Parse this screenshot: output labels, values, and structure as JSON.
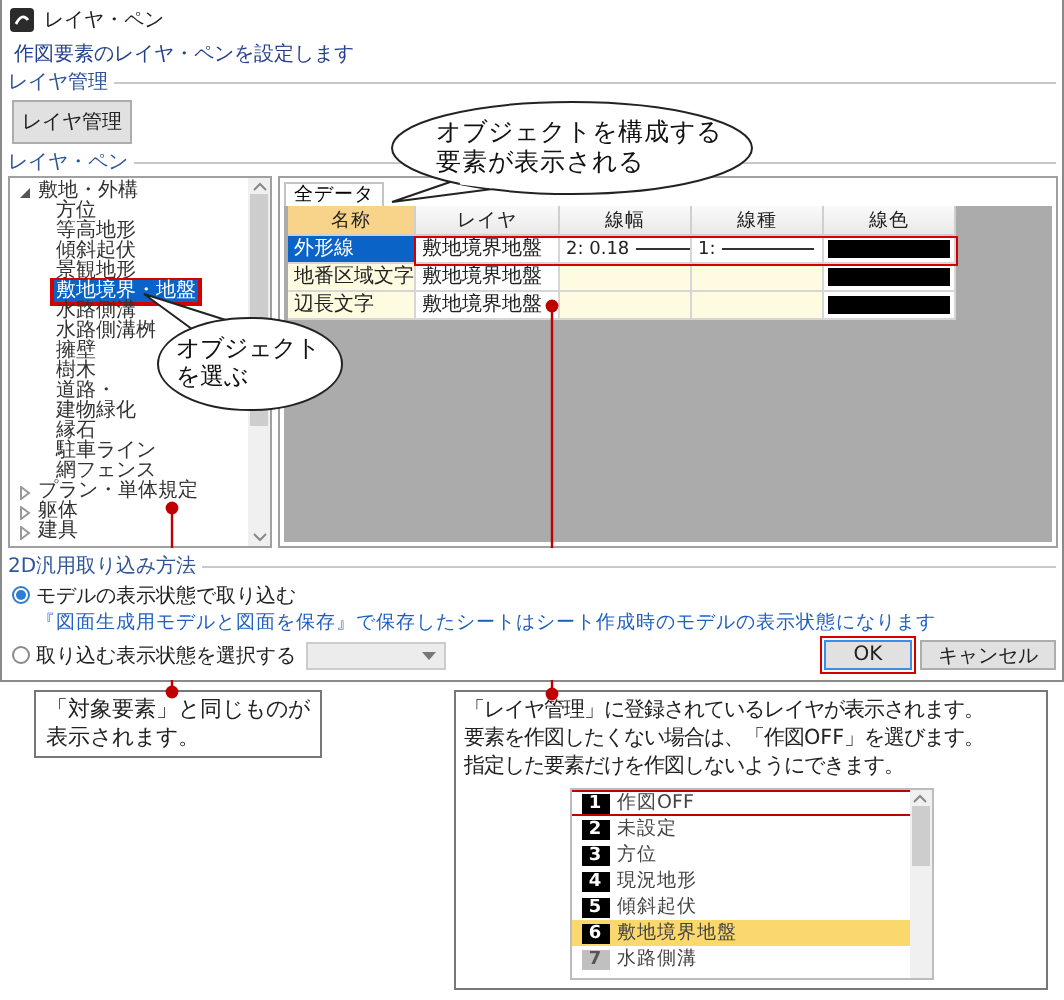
{
  "window": {
    "title": "レイヤ・ペン"
  },
  "description": "作図要素のレイヤ・ペンを設定します",
  "layer_management": {
    "label": "レイヤ管理",
    "button": "レイヤ管理"
  },
  "layer_pen": {
    "label": "レイヤ・ペン",
    "tree": [
      {
        "label": "敷地・外構",
        "expanded": true,
        "selected": false,
        "highlighted": false,
        "children": [
          {
            "label": "方位",
            "selected": false,
            "highlighted": false
          },
          {
            "label": "等高地形",
            "selected": false,
            "highlighted": false
          },
          {
            "label": "傾斜起伏",
            "selected": false,
            "highlighted": false
          },
          {
            "label": "景観地形",
            "selected": false,
            "highlighted": false
          },
          {
            "label": "敷地境界・地盤",
            "selected": true,
            "highlighted": true
          },
          {
            "label": "水路側溝",
            "selected": false,
            "highlighted": false
          },
          {
            "label": "水路側溝桝",
            "selected": false,
            "highlighted": false
          },
          {
            "label": "擁壁",
            "selected": false,
            "highlighted": false
          },
          {
            "label": "樹木",
            "selected": false,
            "highlighted": false
          },
          {
            "label": "道路・",
            "selected": false,
            "highlighted": false
          },
          {
            "label": "建物緑化",
            "selected": false,
            "highlighted": false
          },
          {
            "label": "縁石",
            "selected": false,
            "highlighted": false
          },
          {
            "label": "駐車ライン",
            "selected": false,
            "highlighted": false
          },
          {
            "label": "網フェンス",
            "selected": false,
            "highlighted": false
          }
        ]
      },
      {
        "label": "プラン・単体規定",
        "expanded": false,
        "selected": false,
        "highlighted": false
      },
      {
        "label": "躯体",
        "expanded": false,
        "selected": false,
        "highlighted": false
      },
      {
        "label": "建具",
        "expanded": false,
        "selected": false,
        "highlighted": false
      }
    ],
    "tabs": [
      {
        "label": "全データ",
        "selected": true
      }
    ],
    "table": {
      "columns": [
        "名称",
        "レイヤ",
        "線幅",
        "線種",
        "線色"
      ],
      "rows": [
        {
          "name": "外形線",
          "layer": "敷地境界地盤",
          "line_width": "2: 0.18",
          "line_type": "1:",
          "selected": true,
          "highlighted": true
        },
        {
          "name": "地番区域文字",
          "layer": "敷地境界地盤",
          "selected": false,
          "highlighted": false
        },
        {
          "name": "辺長文字",
          "layer": "敷地境界地盤",
          "selected": false,
          "highlighted": false
        }
      ]
    }
  },
  "import_method": {
    "label": "2D汎用取り込み方法",
    "options": [
      {
        "label": "モデルの表示状態で取り込む",
        "selected": true,
        "note": "『図面生成用モデルと図面を保存』で保存したシートはシート作成時のモデルの表示状態になります"
      },
      {
        "label": "取り込む表示状態を選択する",
        "selected": false
      }
    ],
    "dropdown": {
      "disabled": true
    }
  },
  "buttons": [
    {
      "label": "OK",
      "default": true,
      "highlighted": true
    },
    {
      "label": "キャンセル",
      "default": false,
      "highlighted": false
    }
  ],
  "callouts": [
    {
      "lines": [
        "オブジェクトを構成する",
        "要素が表示される"
      ]
    },
    {
      "lines": [
        "オブジェクト",
        "を選ぶ"
      ]
    }
  ],
  "notes": [
    {
      "lines": [
        "「対象要素」と同じものが",
        "表示されます。"
      ]
    },
    {
      "lines": [
        "「レイヤ管理」に登録されているレイヤが表示されます。",
        "要素を作図したくない場合は、「作図OFF」を選びます。",
        "指定した要素だけを作図しないようにできます。"
      ],
      "layer_list": [
        {
          "number": "1",
          "label": "作図OFF",
          "color": "#000000",
          "selected": false,
          "highlighted": true
        },
        {
          "number": "2",
          "label": "未設定",
          "color": "#000000",
          "selected": false,
          "highlighted": false
        },
        {
          "number": "3",
          "label": "方位",
          "color": "#000000",
          "selected": false,
          "highlighted": false
        },
        {
          "number": "4",
          "label": "現況地形",
          "color": "#000000",
          "selected": false,
          "highlighted": false
        },
        {
          "number": "5",
          "label": "傾斜起伏",
          "color": "#000000",
          "selected": false,
          "highlighted": false
        },
        {
          "number": "6",
          "label": "敷地境界地盤",
          "color": "#000000",
          "selected": true,
          "highlighted": false
        },
        {
          "number": "7",
          "label": "水路側溝",
          "color": "#c0c0c0",
          "selected": false,
          "highlighted": false
        }
      ]
    }
  ]
}
